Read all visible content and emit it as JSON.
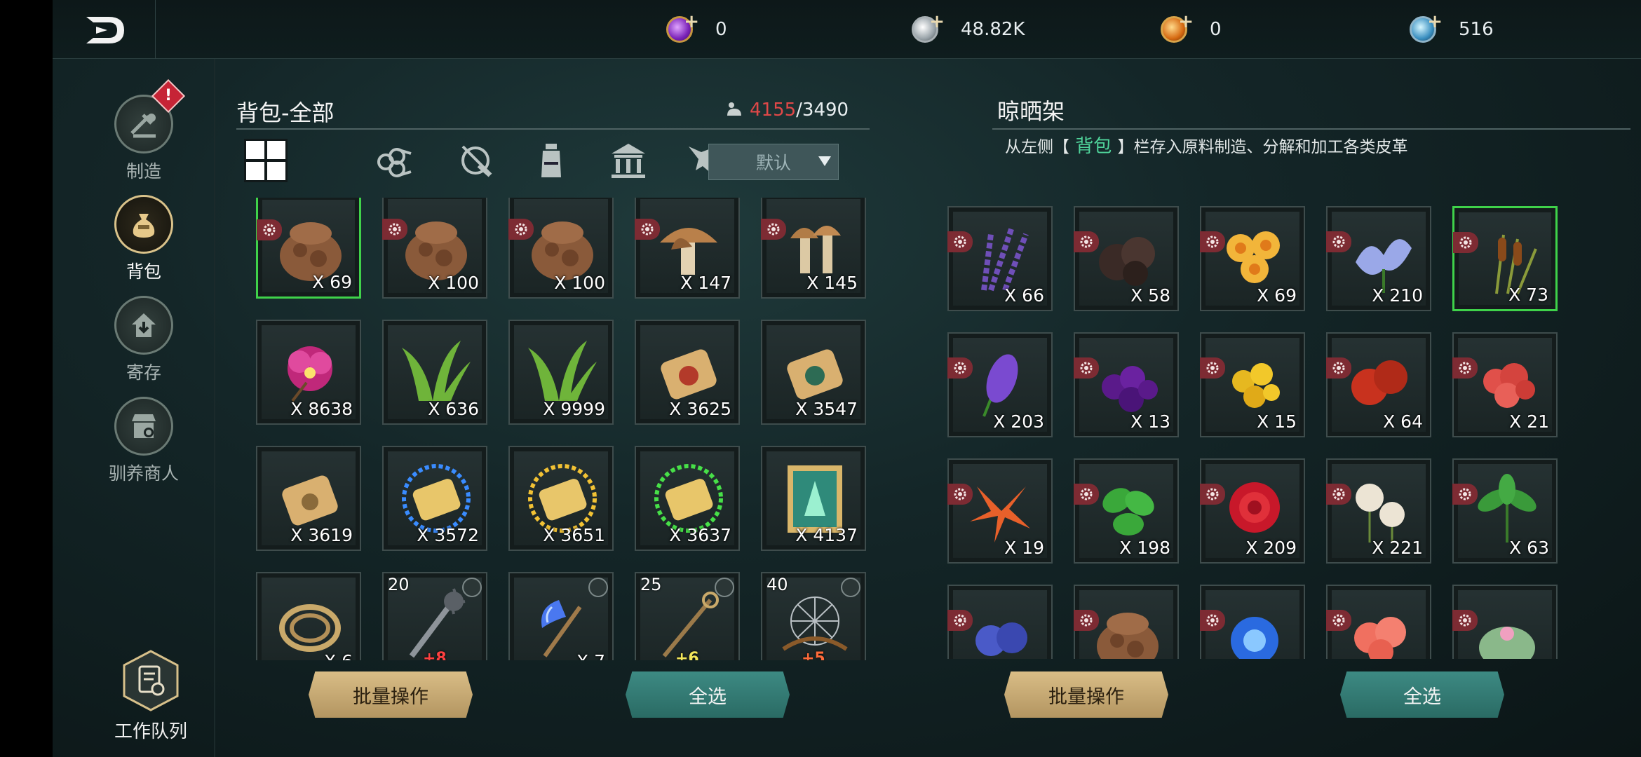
{
  "currencies": [
    {
      "icon": "purple-gem-icon",
      "amount": "0",
      "color": "#9b3fd6"
    },
    {
      "icon": "silver-coin-icon",
      "amount": "48.82K",
      "color": "#c8d0d6"
    },
    {
      "icon": "gold-coin-icon",
      "amount": "0",
      "color": "#e0962b"
    },
    {
      "icon": "blue-crystal-icon",
      "amount": "516",
      "color": "#4a9fc9"
    }
  ],
  "nav": {
    "craft": "制造",
    "bag": "背包",
    "storage": "寄存",
    "merchant": "驯养商人",
    "queue": "工作队列"
  },
  "bag": {
    "title": "背包-全部",
    "count_current": "4155",
    "count_max": "/3490",
    "sort_label": "默认",
    "filters": [
      "grid-icon",
      "wood-icon",
      "ore-icon",
      "potion-icon",
      "building-icon",
      "beast-icon"
    ],
    "items": [
      {
        "art": "sack",
        "qty": "X 69",
        "gear": true,
        "sel": true
      },
      {
        "art": "sack",
        "qty": "X 100",
        "gear": true
      },
      {
        "art": "sack",
        "qty": "X 100",
        "gear": true
      },
      {
        "art": "mushroom",
        "qty": "X 147",
        "gear": true
      },
      {
        "art": "mushroom2",
        "qty": "X 145",
        "gear": true
      },
      {
        "art": "orchid",
        "qty": "X 8638"
      },
      {
        "art": "grass",
        "qty": "X 636"
      },
      {
        "art": "grass",
        "qty": "X 9999"
      },
      {
        "art": "scroll-red",
        "qty": "X 3625"
      },
      {
        "art": "scroll-green",
        "qty": "X 3547"
      },
      {
        "art": "scroll-plain",
        "qty": "X 3619"
      },
      {
        "art": "scroll-blue",
        "qty": "X 3572"
      },
      {
        "art": "scroll-gold",
        "qty": "X 3651"
      },
      {
        "art": "scroll-glow",
        "qty": "X 3637"
      },
      {
        "art": "map",
        "qty": "X 4137"
      },
      {
        "art": "rope",
        "qty": "X 6"
      },
      {
        "art": "mace",
        "qty": "",
        "lvl": "20",
        "plus": "+8",
        "plus_color": "#ff4040",
        "bar": "#e8e34a",
        "link": true
      },
      {
        "art": "axe",
        "qty": "X 7",
        "link": true
      },
      {
        "art": "staff",
        "qty": "",
        "lvl": "25",
        "plus": "+6",
        "plus_color": "#f2e65a",
        "bar": "#e8e34a",
        "link": true
      },
      {
        "art": "bow",
        "qty": "",
        "lvl": "40",
        "plus": "+5",
        "plus_color": "#ff6b3a",
        "bar": "#e8e34a",
        "link": true
      }
    ],
    "batch_label": "批量操作",
    "select_all_label": "全选"
  },
  "rack": {
    "title": "晾晒架",
    "desc_pre": "从左侧【",
    "desc_hl": " 背包 ",
    "desc_post": "】栏存入原料制造、分解和加工各类皮革",
    "items": [
      {
        "art": "lavender",
        "qty": "X 66",
        "gear": true
      },
      {
        "art": "truffle",
        "qty": "X 58",
        "gear": true
      },
      {
        "art": "daffodil",
        "qty": "X 69",
        "gear": true
      },
      {
        "art": "iris",
        "qty": "X 210",
        "gear": true
      },
      {
        "art": "cattail",
        "qty": "X 73",
        "gear": true,
        "sel": true
      },
      {
        "art": "lupine",
        "qty": "X 203",
        "gear": true
      },
      {
        "art": "berries",
        "qty": "X 13",
        "gear": true
      },
      {
        "art": "yellowflower",
        "qty": "X 15",
        "gear": true
      },
      {
        "art": "redfruit",
        "qty": "X 64",
        "gear": true
      },
      {
        "art": "coral",
        "qty": "X 21",
        "gear": true
      },
      {
        "art": "lily",
        "qty": "X 19",
        "gear": true
      },
      {
        "art": "mint",
        "qty": "X 198",
        "gear": true
      },
      {
        "art": "peony",
        "qty": "X 209",
        "gear": true
      },
      {
        "art": "dandelion",
        "qty": "X 221",
        "gear": true
      },
      {
        "art": "leaves",
        "qty": "X 63",
        "gear": true
      },
      {
        "art": "cornflower",
        "qty": "",
        "gear": true
      },
      {
        "art": "sack",
        "qty": "",
        "gear": true
      },
      {
        "art": "blueflower",
        "qty": "",
        "gear": true
      },
      {
        "art": "pinkflower",
        "qty": "",
        "gear": true
      },
      {
        "art": "cactus",
        "qty": "",
        "gear": true
      }
    ],
    "batch_label": "批量操作",
    "select_all_label": "全选"
  }
}
